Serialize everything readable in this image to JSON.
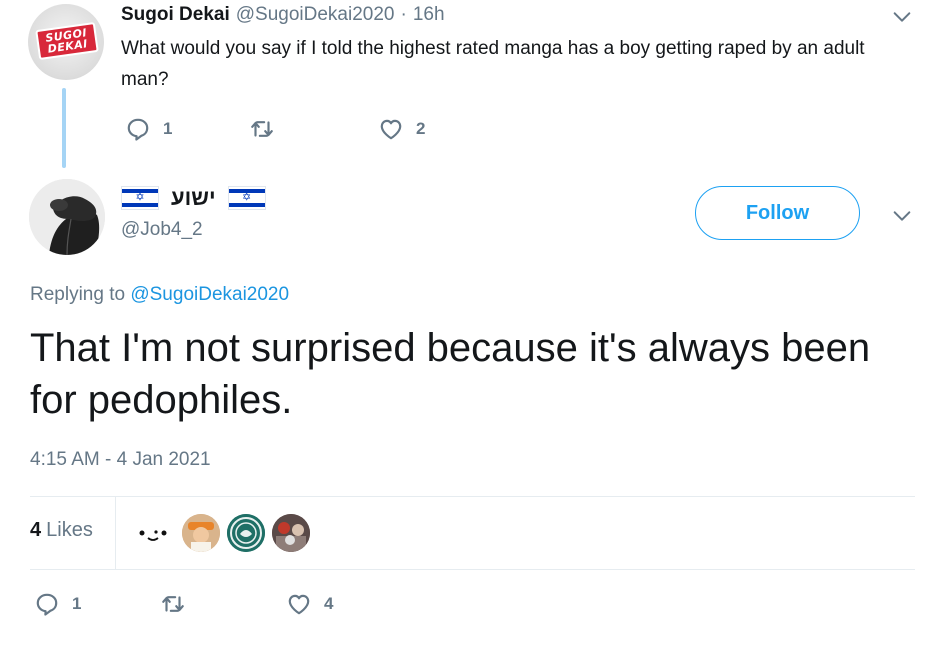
{
  "parent_tweet": {
    "display_name": "Sugoi Dekai",
    "handle": "@SugoiDekai2020",
    "separator": "·",
    "time": "16h",
    "text": "What would you say if I told the highest rated manga has a boy getting raped by an adult man?",
    "avatar_logo_line1": "SUGOI",
    "avatar_logo_line2": "DEKAI",
    "reply_count": "1",
    "like_count": "2",
    "icons": [
      "reply-icon",
      "retweet-icon",
      "like-icon",
      "chevron-down-icon"
    ]
  },
  "main_tweet": {
    "display_name": "ישוע",
    "handle": "@Job4_2",
    "follow_label": "Follow",
    "replying_prefix": "Replying to",
    "replying_to": "@SugoiDekai2020",
    "text": "That I'm not surprised because it's always been for pedophiles.",
    "timestamp": "4:15 AM - 4 Jan 2021",
    "likes_count": "4",
    "likes_label": "Likes",
    "reply_count": "1",
    "like_count": "4",
    "icons": [
      "israel-flag-icon",
      "reply-icon",
      "retweet-icon",
      "like-icon",
      "chevron-down-icon"
    ]
  },
  "colors": {
    "accent": "#1da1f2",
    "link": "#1b95e0",
    "secondary_text": "#657786",
    "primary_text": "#14171a",
    "thread_line": "#a5d4f5",
    "flag_blue": "#0038b8"
  }
}
